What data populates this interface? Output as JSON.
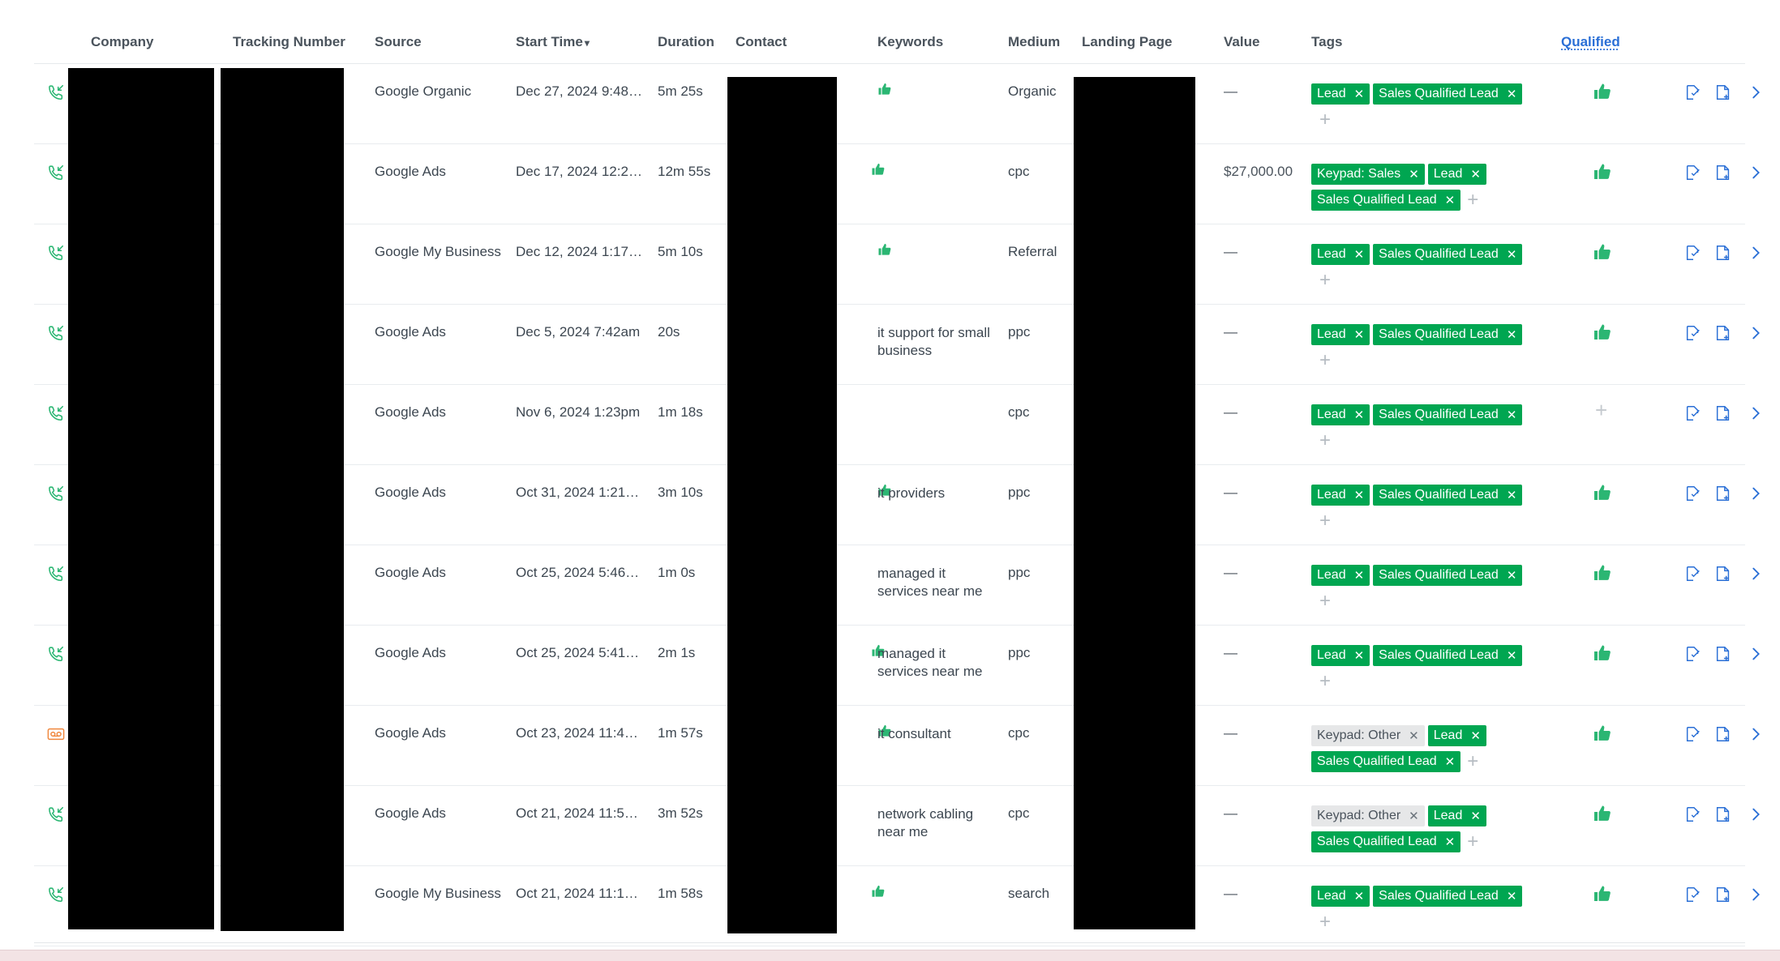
{
  "columns": {
    "company": "Company",
    "tracking_number": "Tracking Number",
    "source": "Source",
    "start_time": "Start Time",
    "duration": "Duration",
    "contact": "Contact",
    "keywords": "Keywords",
    "medium": "Medium",
    "landing_page": "Landing Page",
    "value": "Value",
    "tags": "Tags",
    "qualified": "Qualified"
  },
  "sort_indicator": "▾",
  "rows": [
    {
      "call_type": "answered",
      "source": "Google Organic",
      "start_time": "Dec 27, 2024 9:48…",
      "duration": "5m 25s",
      "keywords": "",
      "medium": "Organic",
      "value": "—",
      "contact_suffix": ".",
      "tags": [
        {
          "label": "Lead",
          "style": "green"
        },
        {
          "label": "Sales Qualified Lead",
          "style": "green"
        }
      ],
      "qualified": "thumbs-up"
    },
    {
      "call_type": "answered",
      "source": "Google Ads",
      "start_time": "Dec 17, 2024 12:2…",
      "duration": "12m 55s",
      "keywords": "",
      "medium": "cpc",
      "value": "$27,000.00",
      "contact_suffix": "",
      "tags": [
        {
          "label": "Keypad: Sales",
          "style": "green"
        },
        {
          "label": "Lead",
          "style": "green"
        },
        {
          "label": "Sales Qualified Lead",
          "style": "green"
        }
      ],
      "qualified": "thumbs-up"
    },
    {
      "call_type": "answered",
      "source": "Google My Business",
      "start_time": "Dec 12, 2024 1:17…",
      "duration": "5m 10s",
      "keywords": "",
      "medium": "Referral",
      "value": "—",
      "contact_suffix": ".",
      "tags": [
        {
          "label": "Lead",
          "style": "green"
        },
        {
          "label": "Sales Qualified Lead",
          "style": "green"
        }
      ],
      "qualified": "thumbs-up"
    },
    {
      "call_type": "answered",
      "source": "Google Ads",
      "start_time": "Dec 5, 2024 7:42am",
      "duration": "20s",
      "keywords": "it support for small business",
      "medium": "ppc",
      "value": "—",
      "contact_suffix": "",
      "tags": [
        {
          "label": "Lead",
          "style": "green"
        },
        {
          "label": "Sales Qualified Lead",
          "style": "green"
        }
      ],
      "qualified": "thumbs-up"
    },
    {
      "call_type": "answered",
      "source": "Google Ads",
      "start_time": "Nov 6, 2024 1:23pm",
      "duration": "1m 18s",
      "keywords": "",
      "medium": "cpc",
      "value": "—",
      "contact_suffix": "",
      "tags": [
        {
          "label": "Lead",
          "style": "green"
        },
        {
          "label": "Sales Qualified Lead",
          "style": "green"
        }
      ],
      "qualified": "none"
    },
    {
      "call_type": "answered",
      "source": "Google Ads",
      "start_time": "Oct 31, 2024 1:21…",
      "duration": "3m 10s",
      "keywords": "it providers",
      "medium": "ppc",
      "value": "—",
      "contact_suffix": "..",
      "tags": [
        {
          "label": "Lead",
          "style": "green"
        },
        {
          "label": "Sales Qualified Lead",
          "style": "green"
        }
      ],
      "qualified": "thumbs-up"
    },
    {
      "call_type": "answered",
      "source": "Google Ads",
      "start_time": "Oct 25, 2024 5:46…",
      "duration": "1m 0s",
      "keywords": "managed it services near me",
      "medium": "ppc",
      "value": "—",
      "contact_suffix": "",
      "tags": [
        {
          "label": "Lead",
          "style": "green"
        },
        {
          "label": "Sales Qualified Lead",
          "style": "green"
        }
      ],
      "qualified": "thumbs-up"
    },
    {
      "call_type": "answered",
      "source": "Google Ads",
      "start_time": "Oct 25, 2024 5:41…",
      "duration": "2m 1s",
      "keywords": "managed it services near me",
      "medium": "ppc",
      "value": "—",
      "contact_suffix": "",
      "tags": [
        {
          "label": "Lead",
          "style": "green"
        },
        {
          "label": "Sales Qualified Lead",
          "style": "green"
        }
      ],
      "qualified": "thumbs-up"
    },
    {
      "call_type": "voicemail",
      "source": "Google Ads",
      "start_time": "Oct 23, 2024 11:4…",
      "duration": "1m 57s",
      "keywords": "it consultant",
      "medium": "cpc",
      "value": "—",
      "contact_suffix": "..",
      "tags": [
        {
          "label": "Keypad: Other",
          "style": "gray"
        },
        {
          "label": "Lead",
          "style": "green"
        },
        {
          "label": "Sales Qualified Lead",
          "style": "green"
        }
      ],
      "qualified": "thumbs-up"
    },
    {
      "call_type": "answered",
      "source": "Google Ads",
      "start_time": "Oct 21, 2024 11:5…",
      "duration": "3m 52s",
      "keywords": "network cabling near me",
      "medium": "cpc",
      "value": "—",
      "contact_suffix": "",
      "tags": [
        {
          "label": "Keypad: Other",
          "style": "gray"
        },
        {
          "label": "Lead",
          "style": "green"
        },
        {
          "label": "Sales Qualified Lead",
          "style": "green"
        }
      ],
      "qualified": "thumbs-up"
    },
    {
      "call_type": "answered",
      "source": "Google My Business",
      "start_time": "Oct 21, 2024 11:1…",
      "duration": "1m 58s",
      "keywords": "",
      "medium": "search",
      "value": "—",
      "contact_suffix": "",
      "tags": [
        {
          "label": "Lead",
          "style": "green"
        },
        {
          "label": "Sales Qualified Lead",
          "style": "green"
        }
      ],
      "qualified": "thumbs-up"
    }
  ],
  "row_actions": [
    "edit-icon",
    "note-add-icon",
    "chevron-right-icon"
  ],
  "colors": {
    "tag_green": "#00a651",
    "tag_gray": "#e6e7e8",
    "link_blue": "#2a6fd6",
    "call_green": "#2bb673",
    "voicemail_orange": "#f0883e"
  }
}
